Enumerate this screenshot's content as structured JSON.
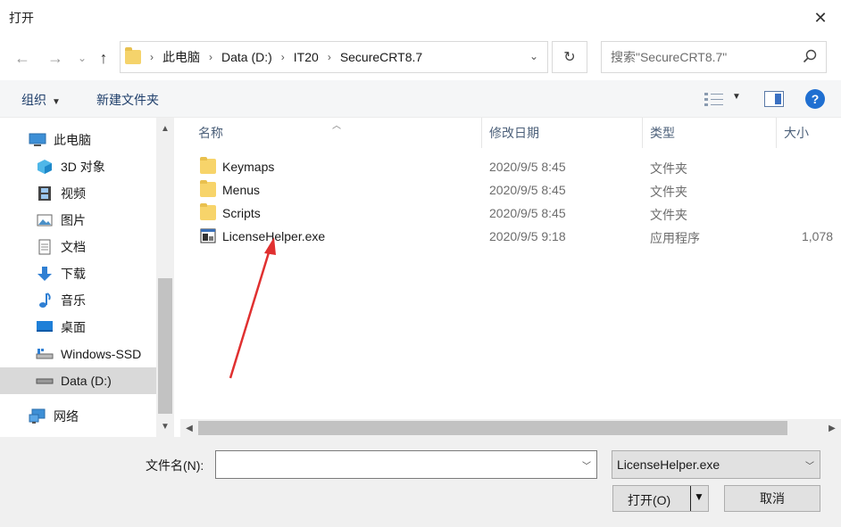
{
  "window": {
    "title": "打开",
    "close_glyph": "✕"
  },
  "nav": {
    "back_glyph": "←",
    "forward_glyph": "→",
    "recent_glyph": "⌄",
    "up_glyph": "↑",
    "breadcrumb": [
      "此电脑",
      "Data (D:)",
      "IT20",
      "SecureCRT8.7"
    ],
    "separator": "›",
    "dropdown_glyph": "⌄",
    "refresh_glyph": "↻",
    "search_placeholder": "搜索\"SecureCRT8.7\""
  },
  "toolbar": {
    "organize": "组织",
    "new_folder": "新建文件夹",
    "help": "?"
  },
  "sidebar": {
    "items": [
      {
        "label": "此电脑",
        "icon": "pc-icon"
      },
      {
        "label": "3D 对象",
        "icon": "3d-objects-icon"
      },
      {
        "label": "视频",
        "icon": "video-icon"
      },
      {
        "label": "图片",
        "icon": "pictures-icon"
      },
      {
        "label": "文档",
        "icon": "documents-icon"
      },
      {
        "label": "下载",
        "icon": "downloads-icon"
      },
      {
        "label": "音乐",
        "icon": "music-icon"
      },
      {
        "label": "桌面",
        "icon": "desktop-icon"
      },
      {
        "label": "Windows-SSD",
        "icon": "drive-icon"
      },
      {
        "label": "Data (D:)",
        "icon": "drive-icon",
        "selected": true
      },
      {
        "label": "网络",
        "icon": "network-icon"
      }
    ]
  },
  "columns": {
    "name": "名称",
    "modified": "修改日期",
    "type": "类型",
    "size": "大小"
  },
  "files": [
    {
      "name": "Keymaps",
      "modified": "2020/9/5 8:45",
      "type": "文件夹",
      "size": "",
      "icon": "folder-icon"
    },
    {
      "name": "Menus",
      "modified": "2020/9/5 8:45",
      "type": "文件夹",
      "size": "",
      "icon": "folder-icon"
    },
    {
      "name": "Scripts",
      "modified": "2020/9/5 8:45",
      "type": "文件夹",
      "size": "",
      "icon": "folder-icon"
    },
    {
      "name": "LicenseHelper.exe",
      "modified": "2020/9/5 9:18",
      "type": "应用程序",
      "size": "1,078",
      "icon": "exe-icon"
    }
  ],
  "bottom": {
    "filename_label": "文件名(N):",
    "filename_value": "",
    "filter_value": "LicenseHelper.exe",
    "open_label": "打开(O)",
    "cancel_label": "取消"
  },
  "colors": {
    "accent": "#1f6fd1",
    "annotation": "#e03030",
    "selection": "#d9d9d9"
  }
}
